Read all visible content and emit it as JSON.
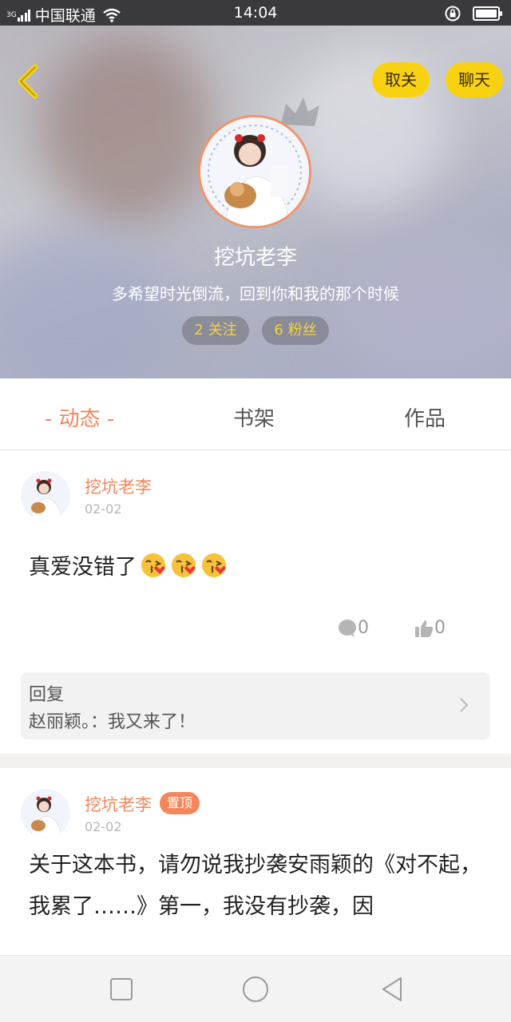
{
  "status_bar": {
    "network": "3G",
    "carrier": "中国联通",
    "time": "14:04"
  },
  "header": {
    "unfollow_label": "取关",
    "chat_label": "聊天",
    "username": "挖坑老李",
    "bio": "多希望时光倒流，回到你和我的那个时候",
    "following": "2 关注",
    "fans": "6 粉丝",
    "accent_color": "#f8d210"
  },
  "tabs": [
    {
      "label": "- 动态 -",
      "active": true
    },
    {
      "label": "书架",
      "active": false
    },
    {
      "label": "作品",
      "active": false
    }
  ],
  "posts": [
    {
      "author": "挖坑老李",
      "date": "02-02",
      "text": "真爱没错了",
      "emojis": [
        "kissing-heart",
        "kissing-heart",
        "kissing-heart"
      ],
      "comments": "0",
      "likes": "0",
      "reply": {
        "label": "回复",
        "text": "赵丽颖。：我又来了！"
      }
    },
    {
      "author": "挖坑老李",
      "date": "02-02",
      "badge": "置顶",
      "text": "关于这本书，请勿说我抄袭安雨颖的《对不起，我累了……》第一，我没有抄袭，因"
    }
  ],
  "colors": {
    "orange": "#f4865a",
    "yellow": "#f8d210"
  }
}
